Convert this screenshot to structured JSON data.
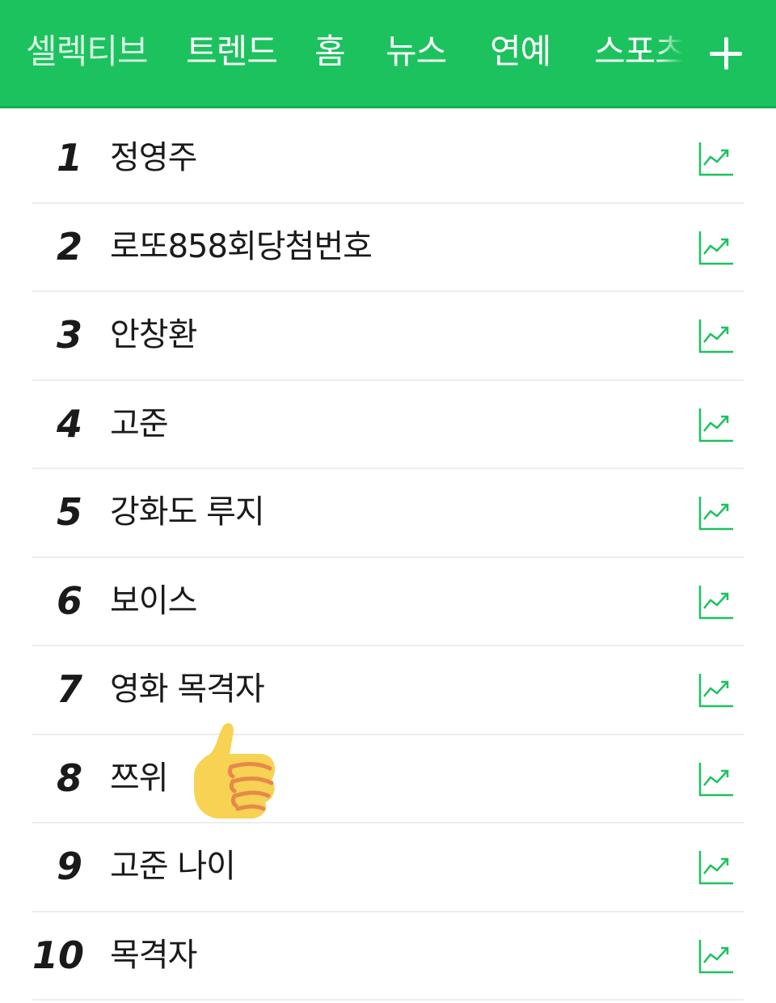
{
  "header": {
    "tabs": [
      {
        "label": "셀렉티브"
      },
      {
        "label": "트렌드"
      },
      {
        "label": "홈"
      },
      {
        "label": "뉴스"
      },
      {
        "label": "연예"
      },
      {
        "label": "스포츠"
      }
    ],
    "add_icon": "plus-icon"
  },
  "colors": {
    "brand_green": "#1cc25e",
    "trend_icon": "#1cc25e",
    "text": "#1a1a1a",
    "divider": "#ededed"
  },
  "ranking": {
    "items": [
      {
        "rank": "1",
        "keyword": "정영주"
      },
      {
        "rank": "2",
        "keyword": "로또858회당첨번호"
      },
      {
        "rank": "3",
        "keyword": "안창환"
      },
      {
        "rank": "4",
        "keyword": "고준"
      },
      {
        "rank": "5",
        "keyword": "강화도 루지"
      },
      {
        "rank": "6",
        "keyword": "보이스"
      },
      {
        "rank": "7",
        "keyword": "영화 목격자"
      },
      {
        "rank": "8",
        "keyword": "쯔위"
      },
      {
        "rank": "9",
        "keyword": "고준 나이"
      },
      {
        "rank": "10",
        "keyword": "목격자"
      }
    ],
    "row_icon": "trend-chart-icon"
  },
  "overlay": {
    "icon": "thumbs-up-emoji"
  }
}
